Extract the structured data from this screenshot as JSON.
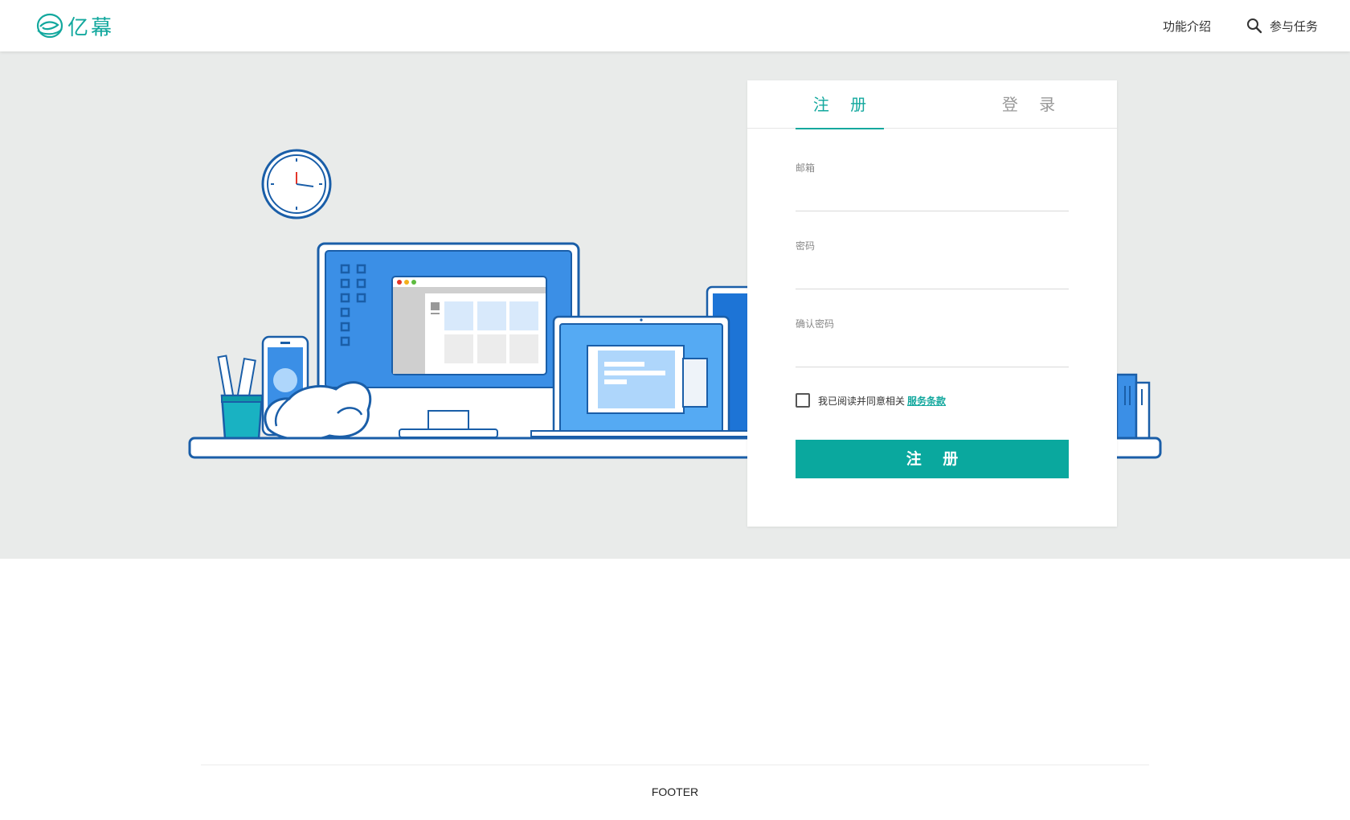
{
  "header": {
    "logo_text": "亿幕",
    "nav": {
      "features": "功能介绍",
      "tasks": "参与任务"
    }
  },
  "form": {
    "tabs": {
      "register": "注 册",
      "login": "登 录"
    },
    "email_label": "邮箱",
    "password_label": "密码",
    "confirm_label": "确认密码",
    "agree_text": "我已阅读并同意相关",
    "terms_link": "服务条款",
    "submit_label": "注 册"
  },
  "footer": {
    "text": "FOOTER"
  },
  "colors": {
    "accent": "#13a89e",
    "hero_bg": "#e9ebea",
    "illustration_blue": "#1a5ea8"
  },
  "icons": [
    "logo-icon",
    "search-icon",
    "clock-icon",
    "monitor-icon",
    "laptop-icon",
    "phone-icon",
    "pencil-cup-icon",
    "cat-icon",
    "books-icon"
  ]
}
